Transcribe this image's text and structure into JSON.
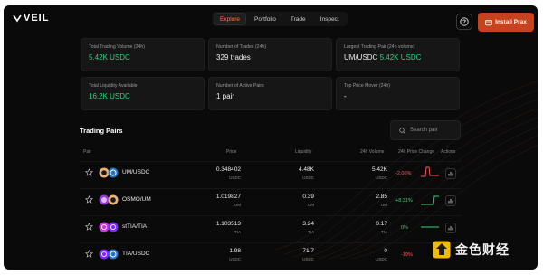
{
  "brand": {
    "name": "VEIL"
  },
  "nav": {
    "tabs": [
      {
        "label": "Explore",
        "active": true
      },
      {
        "label": "Portfolio",
        "active": false
      },
      {
        "label": "Trade",
        "active": false
      },
      {
        "label": "Inspect",
        "active": false
      }
    ]
  },
  "header": {
    "install_label": "Install Prax",
    "help_icon": "help-circle-icon"
  },
  "stats": [
    {
      "label": "Total Trading Volume (24h)",
      "value": "5.42K USDC"
    },
    {
      "label": "Number of Trades (24h)",
      "value": "329 trades"
    },
    {
      "label": "Largest Trading Pair (24h volume)",
      "value_pair": "UM/USDC",
      "value": "5.42K USDC"
    },
    {
      "label": "Total Liquidity Available",
      "value": "16.2K USDC"
    },
    {
      "label": "Number of Active Pairs",
      "value": "1 pair"
    },
    {
      "label": "Top Price Mover (24h)",
      "value": "-"
    }
  ],
  "pairs": {
    "title": "Trading Pairs",
    "search_placeholder": "Search pair",
    "columns": [
      "Pair",
      "Price",
      "Liquidity",
      "24h Volume",
      "24h Price Change",
      "Actions"
    ],
    "rows": [
      {
        "pair": "UM/USDC",
        "price": "0.348402",
        "price_unit": "USDC",
        "liquidity": "4.48K",
        "liquidity_unit": "USDC",
        "volume": "5.42K",
        "volume_unit": "USDC",
        "change": "-2.06%",
        "direction": "down"
      },
      {
        "pair": "OSMO/UM",
        "price": "1.019827",
        "price_unit": "UM",
        "liquidity": "0.39",
        "liquidity_unit": "UM",
        "volume": "2.85",
        "volume_unit": "UM",
        "change": "+8.31%",
        "direction": "up"
      },
      {
        "pair": "stTIA/TIA",
        "price": "1.103513",
        "price_unit": "TIA",
        "liquidity": "3.24",
        "liquidity_unit": "TIA",
        "volume": "0.17",
        "volume_unit": "TIA",
        "change": "0%",
        "direction": "up"
      },
      {
        "pair": "TIA/USDC",
        "price": "1.98",
        "price_unit": "USDC",
        "liquidity": "71.7",
        "liquidity_unit": "USDC",
        "volume": "0",
        "volume_unit": "USDC",
        "change": "-19%",
        "direction": "down"
      }
    ]
  },
  "watermark": {
    "text": "金色财经"
  },
  "colors": {
    "accent": "#ff7a3d",
    "install_button": "#c5431e",
    "positive": "#35d07f",
    "negative": "#ff5a5a",
    "background": "#0a0a0a"
  }
}
